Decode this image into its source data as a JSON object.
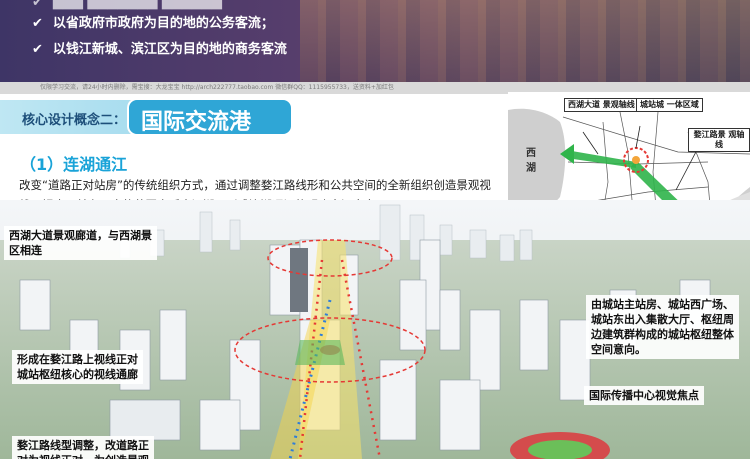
{
  "banner": {
    "bullets": [
      "以省政府市政府为目的地的公务客流；",
      "以钱江新城、滨江区为目的地的商务客流"
    ],
    "watermark": "仅限学习交流，请24小时内删除，需宝搜：大龙宝宝    http://arch222777.taobao.com    微信群QQ：1115955733，送资料+加红包"
  },
  "title": {
    "small": "核心设计概念二：",
    "big": "国际交流港"
  },
  "section": {
    "subtitle": "（1）连湖通江",
    "paragraph": "改变“道路正对站房”的传统组织方式，通过调整婺江路线形和公共空间的全新组织创造景观视线双视廊，并在更大的范围内呼应江湖，形成连湖通江的明确空间意向。"
  },
  "map": {
    "labels": {
      "xihu_axis": "西湖大道\n景观轴线",
      "station_area": "城站城\n一体区域",
      "wujiang_axis": "婺江路景\n观轴线"
    },
    "water": {
      "xihu": "西\n湖",
      "river_1": "江",
      "river_2": "塘",
      "river_3": "钱"
    },
    "colors": {
      "green_axis": "#2fb44a",
      "red_circle": "#e53935"
    }
  },
  "render": {
    "callouts": {
      "top_left": "西湖大道景观廊道，与西湖景\n区相连",
      "right_top": "由城站主站房、城站西广场、\n城站东出入集散大厅、枢纽周\n边建筑群构成的城站枢纽整体\n空间意向。",
      "mid_left": "形成在婺江路上视线正对\n城站枢纽核心的视线通廊",
      "right_bottom": "国际传播中心视觉焦点",
      "bottom_left": "婺江路线型调整，改道路正\n对为视线正对，为创造景观"
    }
  }
}
